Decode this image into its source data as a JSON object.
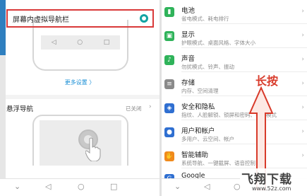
{
  "left": {
    "nav_option_label": "屏幕内虚拟导航栏",
    "more_settings": "更多设置 〉",
    "float_nav_title": "悬浮导航",
    "float_nav_status": "已关闭",
    "chevron": "›",
    "phone_nav": {
      "back": "◁",
      "home": "○",
      "recent": "□"
    },
    "system_nav": {
      "down": "⌄",
      "back": "◁",
      "home": "○",
      "recent": "□"
    }
  },
  "settings": {
    "items": [
      {
        "title": "电池",
        "subtitle": "省电模式、耗电排行",
        "icon": "battery-icon",
        "color": "#2fb35a"
      },
      {
        "title": "显示",
        "subtitle": "护眼模式、桌面风格、字体大小",
        "icon": "display-icon",
        "color": "#2fb35a"
      },
      {
        "title": "声音",
        "subtitle": "勿扰模式、铃声、振动",
        "icon": "sound-icon",
        "color": "#2fb35a"
      },
      {
        "title": "存储",
        "subtitle": "内存、空间清理",
        "icon": "storage-icon",
        "color": "#8a8a8a"
      },
      {
        "title": "安全和隐私",
        "subtitle": "指纹、人脸解锁、锁屏和密码、学生模式",
        "icon": "security-icon",
        "color": "#2f6fd1"
      },
      {
        "title": "用户和帐户",
        "subtitle": "多用户、云空间、帐户",
        "icon": "user-icon",
        "color": "#2f6fd1"
      },
      {
        "title": "智能辅助",
        "subtitle": "系统导航、一键截屏、语音控制",
        "icon": "assist-icon",
        "color": "#f08a1c"
      },
      {
        "title": "Google",
        "subtitle": "",
        "icon": "google-icon",
        "color": "#2f6fd1"
      }
    ],
    "chevron": "›"
  },
  "annotation": {
    "text": "长按"
  },
  "right_nav": {
    "down": "⌄",
    "back": "◁",
    "home": "○"
  },
  "watermark": {
    "main": "飞翔下载",
    "sub": "www.52z.com"
  }
}
